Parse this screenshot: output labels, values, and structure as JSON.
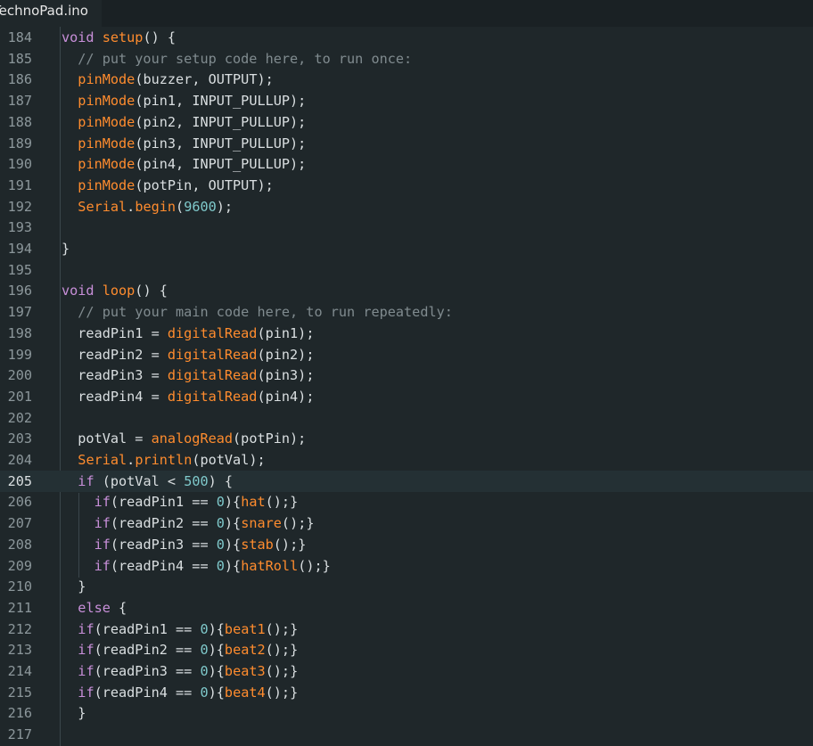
{
  "tab": {
    "filename": "TechnoPad.ino"
  },
  "editor": {
    "active_line": 205,
    "lines": [
      {
        "n": "184",
        "tokens": [
          [
            "kw",
            "void "
          ],
          [
            "fn",
            "setup"
          ],
          [
            "tx",
            "() {"
          ]
        ]
      },
      {
        "n": "185",
        "tokens": [
          [
            "cm",
            "  // put your setup code here, to run once:"
          ]
        ]
      },
      {
        "n": "186",
        "tokens": [
          [
            "tx",
            "  "
          ],
          [
            "fn",
            "pinMode"
          ],
          [
            "tx",
            "(buzzer, OUTPUT);"
          ]
        ]
      },
      {
        "n": "187",
        "tokens": [
          [
            "tx",
            "  "
          ],
          [
            "fn",
            "pinMode"
          ],
          [
            "tx",
            "(pin1, INPUT_PULLUP);"
          ]
        ]
      },
      {
        "n": "188",
        "tokens": [
          [
            "tx",
            "  "
          ],
          [
            "fn",
            "pinMode"
          ],
          [
            "tx",
            "(pin2, INPUT_PULLUP);"
          ]
        ]
      },
      {
        "n": "189",
        "tokens": [
          [
            "tx",
            "  "
          ],
          [
            "fn",
            "pinMode"
          ],
          [
            "tx",
            "(pin3, INPUT_PULLUP);"
          ]
        ]
      },
      {
        "n": "190",
        "tokens": [
          [
            "tx",
            "  "
          ],
          [
            "fn",
            "pinMode"
          ],
          [
            "tx",
            "(pin4, INPUT_PULLUP);"
          ]
        ]
      },
      {
        "n": "191",
        "tokens": [
          [
            "tx",
            "  "
          ],
          [
            "fn",
            "pinMode"
          ],
          [
            "tx",
            "(potPin, OUTPUT);"
          ]
        ]
      },
      {
        "n": "192",
        "tokens": [
          [
            "tx",
            "  "
          ],
          [
            "fn",
            "Serial"
          ],
          [
            "tx",
            "."
          ],
          [
            "fn",
            "begin"
          ],
          [
            "tx",
            "("
          ],
          [
            "num",
            "9600"
          ],
          [
            "tx",
            ");"
          ]
        ]
      },
      {
        "n": "193",
        "tokens": []
      },
      {
        "n": "194",
        "tokens": [
          [
            "tx",
            "}"
          ]
        ]
      },
      {
        "n": "195",
        "tokens": []
      },
      {
        "n": "196",
        "tokens": [
          [
            "kw",
            "void "
          ],
          [
            "fn",
            "loop"
          ],
          [
            "tx",
            "() {"
          ]
        ]
      },
      {
        "n": "197",
        "tokens": [
          [
            "cm",
            "  // put your main code here, to run repeatedly:"
          ]
        ]
      },
      {
        "n": "198",
        "tokens": [
          [
            "tx",
            "  readPin1 = "
          ],
          [
            "fn",
            "digitalRead"
          ],
          [
            "tx",
            "(pin1);"
          ]
        ]
      },
      {
        "n": "199",
        "tokens": [
          [
            "tx",
            "  readPin2 = "
          ],
          [
            "fn",
            "digitalRead"
          ],
          [
            "tx",
            "(pin2);"
          ]
        ]
      },
      {
        "n": "200",
        "tokens": [
          [
            "tx",
            "  readPin3 = "
          ],
          [
            "fn",
            "digitalRead"
          ],
          [
            "tx",
            "(pin3);"
          ]
        ]
      },
      {
        "n": "201",
        "tokens": [
          [
            "tx",
            "  readPin4 = "
          ],
          [
            "fn",
            "digitalRead"
          ],
          [
            "tx",
            "(pin4);"
          ]
        ]
      },
      {
        "n": "202",
        "tokens": []
      },
      {
        "n": "203",
        "tokens": [
          [
            "tx",
            "  potVal = "
          ],
          [
            "fn",
            "analogRead"
          ],
          [
            "tx",
            "(potPin);"
          ]
        ]
      },
      {
        "n": "204",
        "tokens": [
          [
            "tx",
            "  "
          ],
          [
            "fn",
            "Serial"
          ],
          [
            "tx",
            "."
          ],
          [
            "fn",
            "println"
          ],
          [
            "tx",
            "(potVal);"
          ]
        ]
      },
      {
        "n": "205",
        "tokens": [
          [
            "tx",
            "  "
          ],
          [
            "kw",
            "if"
          ],
          [
            "tx",
            " (potVal < "
          ],
          [
            "num",
            "500"
          ],
          [
            "tx",
            ") {"
          ]
        ]
      },
      {
        "n": "206",
        "tokens": [
          [
            "tx",
            "    "
          ],
          [
            "kw",
            "if"
          ],
          [
            "tx",
            "(readPin1 == "
          ],
          [
            "num",
            "0"
          ],
          [
            "tx",
            "){"
          ],
          [
            "fn",
            "hat"
          ],
          [
            "tx",
            "();}"
          ]
        ]
      },
      {
        "n": "207",
        "tokens": [
          [
            "tx",
            "    "
          ],
          [
            "kw",
            "if"
          ],
          [
            "tx",
            "(readPin2 == "
          ],
          [
            "num",
            "0"
          ],
          [
            "tx",
            "){"
          ],
          [
            "fn",
            "snare"
          ],
          [
            "tx",
            "();}"
          ]
        ]
      },
      {
        "n": "208",
        "tokens": [
          [
            "tx",
            "    "
          ],
          [
            "kw",
            "if"
          ],
          [
            "tx",
            "(readPin3 == "
          ],
          [
            "num",
            "0"
          ],
          [
            "tx",
            "){"
          ],
          [
            "fn",
            "stab"
          ],
          [
            "tx",
            "();}"
          ]
        ]
      },
      {
        "n": "209",
        "tokens": [
          [
            "tx",
            "    "
          ],
          [
            "kw",
            "if"
          ],
          [
            "tx",
            "(readPin4 == "
          ],
          [
            "num",
            "0"
          ],
          [
            "tx",
            "){"
          ],
          [
            "fn",
            "hatRoll"
          ],
          [
            "tx",
            "();}"
          ]
        ]
      },
      {
        "n": "210",
        "tokens": [
          [
            "tx",
            "  }"
          ]
        ]
      },
      {
        "n": "211",
        "tokens": [
          [
            "tx",
            "  "
          ],
          [
            "kw",
            "else"
          ],
          [
            "tx",
            " {"
          ]
        ]
      },
      {
        "n": "212",
        "tokens": [
          [
            "tx",
            "  "
          ],
          [
            "kw",
            "if"
          ],
          [
            "tx",
            "(readPin1 == "
          ],
          [
            "num",
            "0"
          ],
          [
            "tx",
            "){"
          ],
          [
            "fn",
            "beat1"
          ],
          [
            "tx",
            "();}"
          ]
        ]
      },
      {
        "n": "213",
        "tokens": [
          [
            "tx",
            "  "
          ],
          [
            "kw",
            "if"
          ],
          [
            "tx",
            "(readPin2 == "
          ],
          [
            "num",
            "0"
          ],
          [
            "tx",
            "){"
          ],
          [
            "fn",
            "beat2"
          ],
          [
            "tx",
            "();}"
          ]
        ]
      },
      {
        "n": "214",
        "tokens": [
          [
            "tx",
            "  "
          ],
          [
            "kw",
            "if"
          ],
          [
            "tx",
            "(readPin3 == "
          ],
          [
            "num",
            "0"
          ],
          [
            "tx",
            "){"
          ],
          [
            "fn",
            "beat3"
          ],
          [
            "tx",
            "();}"
          ]
        ]
      },
      {
        "n": "215",
        "tokens": [
          [
            "tx",
            "  "
          ],
          [
            "kw",
            "if"
          ],
          [
            "tx",
            "(readPin4 == "
          ],
          [
            "num",
            "0"
          ],
          [
            "tx",
            "){"
          ],
          [
            "fn",
            "beat4"
          ],
          [
            "tx",
            "();}"
          ]
        ]
      },
      {
        "n": "216",
        "tokens": [
          [
            "tx",
            "  }"
          ]
        ]
      },
      {
        "n": "217",
        "tokens": []
      }
    ]
  },
  "colors": {
    "background": "#1f272a",
    "keyword": "#c88fd9",
    "function": "#ff8c2e",
    "number": "#7fc9cb",
    "comment": "#808b8f",
    "text": "#dadfe1",
    "line_number": "#8c979b"
  }
}
